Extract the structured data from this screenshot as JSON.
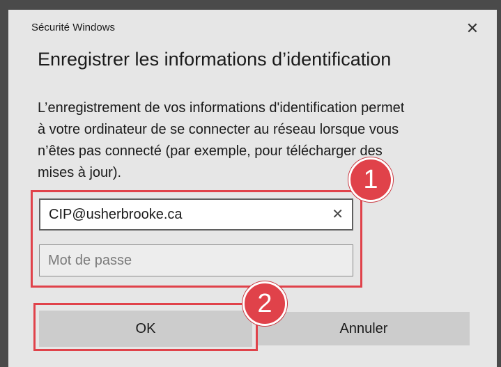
{
  "dialog": {
    "window_title": "Sécurité Windows",
    "heading": "Enregistrer les informations d’identification",
    "description_lines": [
      "L’enregistrement de vos informations d'identification permet",
      "à votre ordinateur de se connecter au réseau lorsque vous",
      "n’êtes pas connecté (par exemple, pour télécharger des",
      "mises à jour)."
    ],
    "close_glyph": "✕"
  },
  "username": {
    "value": "CIP@usherbrooke.ca",
    "clear_glyph": "✕"
  },
  "password": {
    "placeholder": "Mot de passe"
  },
  "buttons": {
    "ok_label": "OK",
    "cancel_label": "Annuler"
  },
  "annotations": {
    "step1": "1",
    "step2": "2",
    "highlight_color": "#e0424a"
  },
  "icons": {
    "close": "close-icon",
    "clear": "clear-icon"
  }
}
